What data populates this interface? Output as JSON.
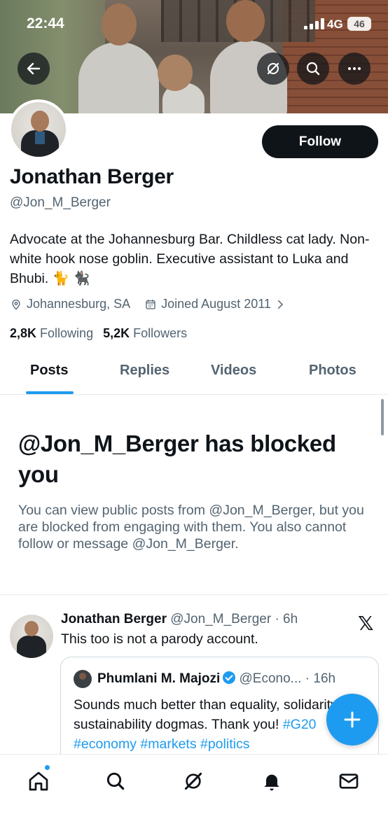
{
  "status_bar": {
    "time": "22:44",
    "network": "4G",
    "battery": "46"
  },
  "profile": {
    "name": "Jonathan Berger",
    "handle": "@Jon_M_Berger",
    "follow_label": "Follow",
    "bio": "Advocate at the Johannesburg Bar. Childless cat lady. Non-white hook nose goblin. Executive assistant to Luka and Bhubi. 🐈 🐈‍⬛",
    "location": "Johannesburg, SA",
    "joined": "Joined August 2011",
    "following_count": "2,8K",
    "following_label": "Following",
    "followers_count": "5,2K",
    "followers_label": "Followers"
  },
  "tabs": [
    {
      "label": "Posts",
      "active": true
    },
    {
      "label": "Replies",
      "active": false
    },
    {
      "label": "Videos",
      "active": false
    },
    {
      "label": "Photos",
      "active": false
    }
  ],
  "blocked": {
    "title": "@Jon_M_Berger has blocked you",
    "description": "You can view public posts from @Jon_M_Berger, but you are blocked from engaging with them. You also cannot follow or message @Jon_M_Berger."
  },
  "post": {
    "author": "Jonathan Berger",
    "handle_time": "@Jon_M_Berger · 6h",
    "text": "This too is not a parody account.",
    "quote": {
      "author": "Phumlani M. Majozi",
      "handle_time": "@Econo... · 16h",
      "text_plain": "Sounds much better than equality, solidarity, sustainability dogmas. Thank you! ",
      "hashtags": "#G20 #economy #markets #politics"
    }
  },
  "colors": {
    "accent": "#1d9bf0",
    "text": "#0f1419",
    "secondary": "#536471"
  }
}
